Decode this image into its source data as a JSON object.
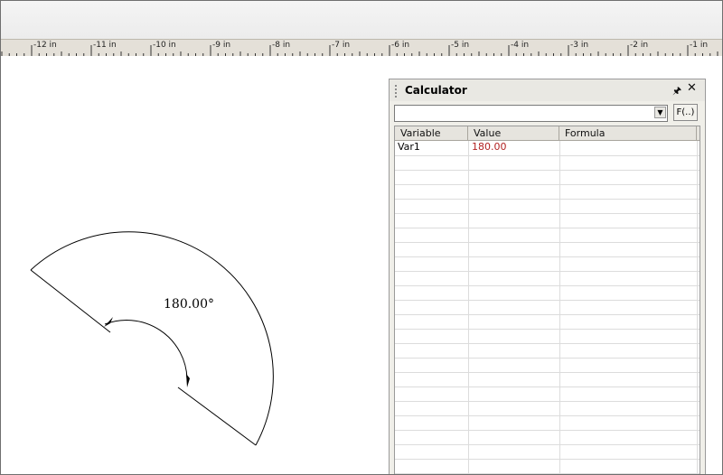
{
  "ruler": {
    "labels": [
      "-12 in",
      "-11 in",
      "-10 in",
      "-9 in",
      "-8 in",
      "-7 in",
      "-6 in",
      "-5 in",
      "-4 in",
      "-3 in",
      "-2 in",
      "-1 in"
    ]
  },
  "drawing": {
    "angle_dimension_text": "180.00°"
  },
  "calculator": {
    "title": "Calculator",
    "formula_value": "",
    "fx_label": "F(..)",
    "columns": [
      "Variable",
      "Value",
      "Formula"
    ],
    "rows": [
      {
        "variable": "Var1",
        "value": "180.00",
        "formula": ""
      }
    ],
    "value_color": "#b22222"
  }
}
